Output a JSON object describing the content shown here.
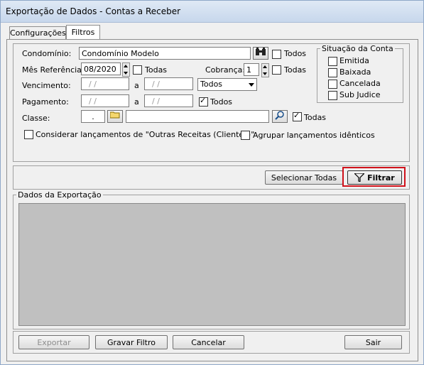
{
  "window": {
    "title": "Exportação de Dados - Contas a Receber"
  },
  "tabs": [
    {
      "label": "Configurações"
    },
    {
      "label": "Filtros"
    }
  ],
  "filters": {
    "condominio_label": "Condomínio:",
    "condominio_value": "Condomínio Modelo",
    "condominio_todos": "Todos",
    "mes_label": "Mês Referência:",
    "mes_value": "08/2020",
    "mes_todas": "Todas",
    "cobranca_label": "Cobrança:",
    "cobranca_value": "1",
    "cobranca_todas": "Todas",
    "vencimento_label": "Vencimento:",
    "vencimento_de": "/ /",
    "vencimento_a_label": "a",
    "vencimento_ate": "/ /",
    "vencimento_tipo": "Todos",
    "pagamento_label": "Pagamento:",
    "pagamento_de": "/ /",
    "pagamento_a_label": "a",
    "pagamento_ate": "/ /",
    "pagamento_todos": "Todos",
    "classe_label": "Classe:",
    "classe_value": ".",
    "classe_todas": "Todas",
    "considerar_label": "Considerar lançamentos de \"Outras Receitas (Clientes)\"",
    "agrupar_label": "Agrupar lançamentos idênticos"
  },
  "situacao": {
    "title": "Situação da Conta",
    "items": [
      "Emitida",
      "Baixada",
      "Cancelada",
      "Sub Judice"
    ]
  },
  "actions": {
    "selecionar_todas": "Selecionar Todas",
    "filtrar": "Filtrar"
  },
  "dados": {
    "title": "Dados da Exportação"
  },
  "footer": {
    "exportar": "Exportar",
    "gravar_filtro": "Gravar Filtro",
    "cancelar": "Cancelar",
    "sair": "Sair"
  }
}
